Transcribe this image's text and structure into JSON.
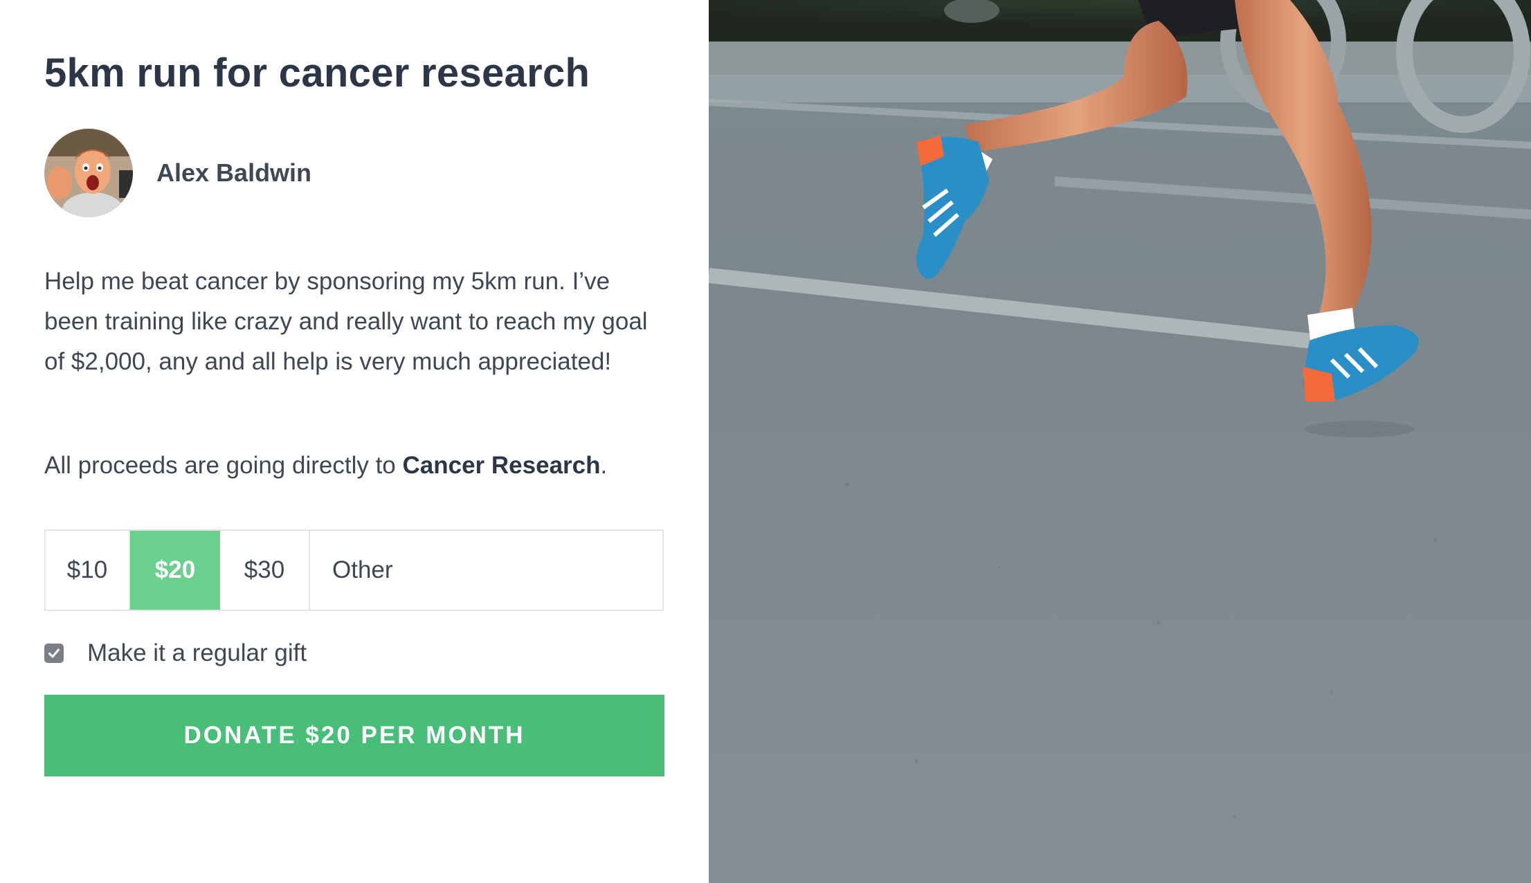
{
  "campaign": {
    "title": "5km run for cancer research",
    "author_name": "Alex Baldwin",
    "description": "Help me beat cancer by sponsoring my 5km run. I’ve been training like crazy and really want to reach my goal of $2,000, any and all help is very much appreciated!",
    "proceeds_prefix": "All proceeds are going directly to ",
    "proceeds_charity": "Cancer Research",
    "proceeds_suffix": "."
  },
  "donation": {
    "amounts": [
      "$10",
      "$20",
      "$30",
      "Other"
    ],
    "selected_amount": "$20",
    "regular_gift_label": "Make it a regular gift",
    "regular_gift_checked": true,
    "donate_button_label": "DONATE $20 PER MONTH"
  },
  "colors": {
    "accent_green": "#49be78",
    "selected_green": "#6ad08e",
    "text_dark": "#2d3646"
  },
  "icons": {
    "checkbox": "check-icon"
  }
}
